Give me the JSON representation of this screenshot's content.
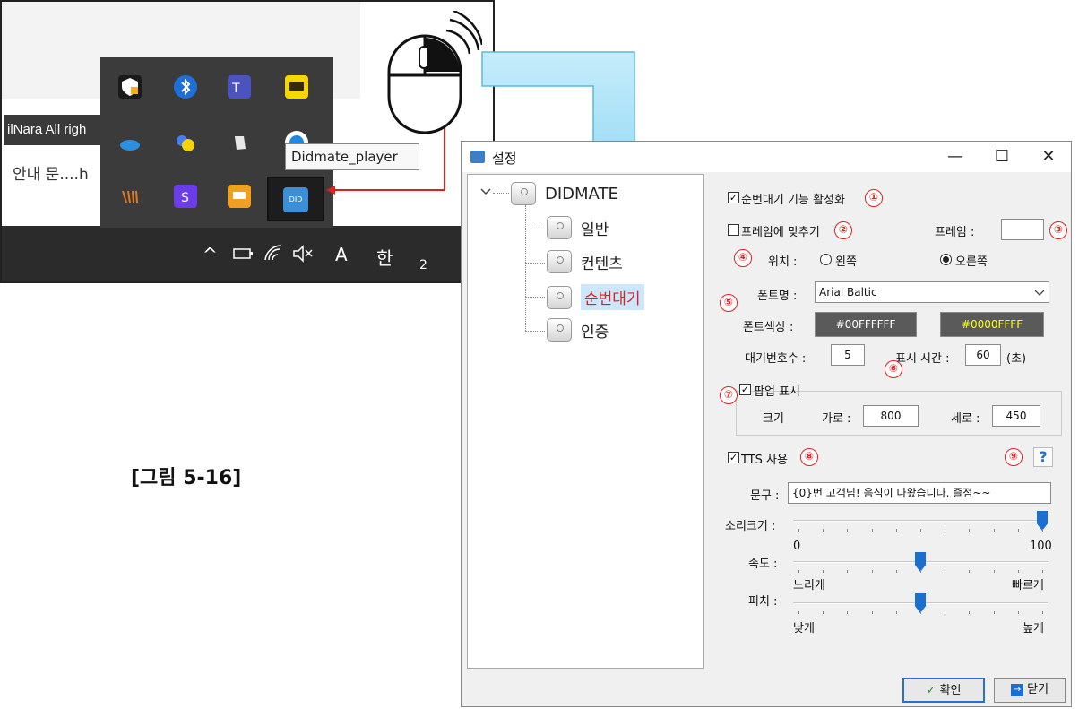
{
  "figure": {
    "caption": "[그림 5-16]"
  },
  "tray_screenshot": {
    "copyright_fragment": "ilNara All righ",
    "notice_fragment": "안내 문....h",
    "tooltip": "Didmate_player",
    "taskbar_time_fragment": "2",
    "ime_label": "A",
    "hangul_label": "한",
    "tray_icons": [
      "security-warning-icon",
      "bluetooth-icon",
      "teams-icon",
      "kakaotalk-icon",
      "onedrive-icon",
      "yellow-dots-icon",
      "evernote-icon",
      "remote-icon",
      "wave-icon",
      "s-app-icon",
      "didmate-orange-icon",
      "didmate-player-icon"
    ],
    "taskbar_icons": [
      "chevron-up-icon",
      "battery-icon",
      "wifi-icon",
      "mute-icon"
    ]
  },
  "window": {
    "title": "설정",
    "controls": {
      "minimize": "—",
      "maximize": "☐",
      "close": "✕"
    }
  },
  "tree": {
    "root": {
      "label": "DIDMATE",
      "icon_letter": "S"
    },
    "children": [
      {
        "label": "일반",
        "icon_letter": "G"
      },
      {
        "label": "컨텐츠",
        "icon_letter": "C"
      },
      {
        "label": "순번대기",
        "icon_letter": "Q",
        "selected": true
      },
      {
        "label": "인증",
        "icon_letter": "C"
      }
    ]
  },
  "settings": {
    "enable_queue": {
      "label": "순번대기 기능 활성화",
      "checked": true,
      "badge": "①"
    },
    "fit_frame": {
      "label": "프레임에 맞추기",
      "checked": false,
      "badge": "②"
    },
    "frame": {
      "label": "프레임 :",
      "value": "",
      "badge": "③"
    },
    "position": {
      "badge": "④",
      "label": "위치 :",
      "left": "왼쪽",
      "right": "오른쪽",
      "selected": "right"
    },
    "font": {
      "badge": "⑤",
      "label": "폰트명 :",
      "value": "Arial Baltic",
      "color_label": "폰트색상 :",
      "color1": "#00FFFFFF",
      "color2": "#0000FFFF",
      "color1_text_hex": "#ffffff",
      "color2_text_hex": "#ffff00"
    },
    "wait_count": {
      "label": "대기번호수 :",
      "value": "5"
    },
    "display_time": {
      "label": "표시 시간 :",
      "value": "60",
      "unit": "(초)",
      "badge": "⑥"
    },
    "popup": {
      "badge": "⑦",
      "label": "팝업 표시",
      "checked": true,
      "size_label": "크기",
      "width_label": "가로 :",
      "width": "800",
      "height_label": "세로 :",
      "height": "450"
    },
    "tts": {
      "label": "TTS 사용",
      "checked": true,
      "badge": "⑧",
      "help_badge": "⑨",
      "help_glyph": "?"
    },
    "phrase": {
      "label": "문구 :",
      "value": "{0}번 고객님! 음식이 나왔습니다. 즐점~~"
    },
    "volume": {
      "label": "소리크기 :",
      "min": "0",
      "max": "100",
      "value": 100
    },
    "speed": {
      "label": "속도 :",
      "min_label": "느리게",
      "max_label": "빠르게",
      "value": 0.5
    },
    "pitch": {
      "label": "피치 :",
      "min_label": "낮게",
      "max_label": "높게",
      "value": 0.5
    }
  },
  "buttons": {
    "ok": {
      "label": "확인",
      "icon": "check-icon"
    },
    "close": {
      "label": "닫기",
      "icon": "exit-icon"
    }
  },
  "colors": {
    "badge_red": "#e02020",
    "accent_blue": "#1a6fd0",
    "selected_text": "#e02020",
    "arrow_fill": "#9fdcf5"
  }
}
